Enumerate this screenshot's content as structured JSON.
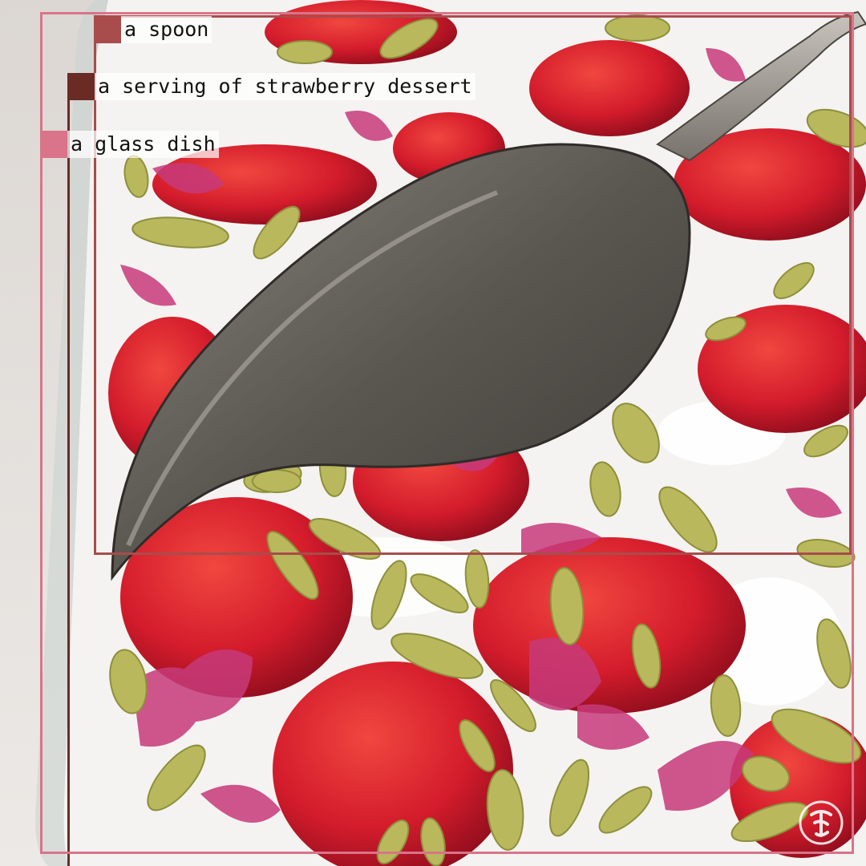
{
  "image": {
    "description_colors": {
      "background": "#e7e2df",
      "cream": "#f6f5f3",
      "strawberry": "#d81f2e",
      "strawberry_dark": "#9e1020",
      "pistachio": "#b6b55a",
      "petal": "#c53b78",
      "spoon": "#5c5751"
    }
  },
  "detections": [
    {
      "label": "a spoon",
      "color": "#a84c4c"
    },
    {
      "label": "a serving of strawberry dessert",
      "color": "#6b2b25"
    },
    {
      "label": "a glass dish",
      "color": "#d9748a"
    }
  ],
  "watermark": {
    "icon": "nyt-logo-icon"
  }
}
